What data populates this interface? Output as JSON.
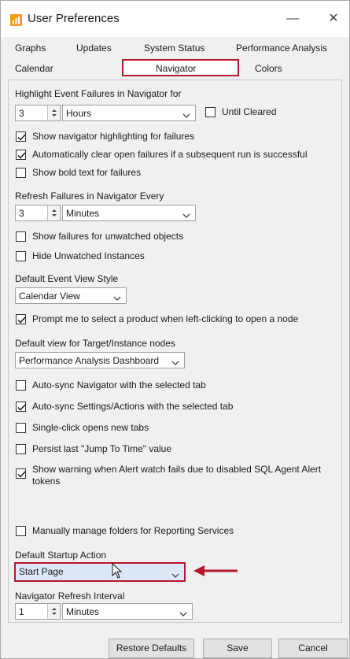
{
  "window": {
    "title": "User Preferences"
  },
  "tabs": {
    "row1": [
      "Graphs",
      "Updates",
      "System Status",
      "Performance Analysis"
    ],
    "row2": [
      "Calendar",
      "Navigator",
      "Colors"
    ],
    "active": "Navigator"
  },
  "highlight": {
    "label": "Highlight Event Failures in Navigator for",
    "value": "3",
    "unit": "Hours",
    "until_cleared": "Until Cleared"
  },
  "options1": [
    {
      "label": "Show navigator highlighting for failures",
      "checked": true
    },
    {
      "label": "Automatically clear open failures if a subsequent run is successful",
      "checked": true
    },
    {
      "label": "Show bold text for failures",
      "checked": false
    }
  ],
  "refresh": {
    "label": "Refresh Failures in Navigator Every",
    "value": "3",
    "unit": "Minutes"
  },
  "options2": [
    {
      "label": "Show failures for unwatched objects",
      "checked": false
    },
    {
      "label": "Hide Unwatched Instances",
      "checked": false
    }
  ],
  "event_view": {
    "label": "Default Event View Style",
    "value": "Calendar View"
  },
  "prompt_select": {
    "label": "Prompt me to select a product when left-clicking to open a node",
    "checked": true
  },
  "target_view": {
    "label": "Default view for Target/Instance nodes",
    "value": "Performance Analysis Dashboard"
  },
  "options3": [
    {
      "label": "Auto-sync Navigator with the selected tab",
      "checked": false
    },
    {
      "label": "Auto-sync Settings/Actions with the selected tab",
      "checked": true
    },
    {
      "label": "Single-click opens new tabs",
      "checked": false
    },
    {
      "label": "Persist last \"Jump To Time\" value",
      "checked": false
    }
  ],
  "warning": {
    "line1": "Show warning when Alert watch fails due to disabled SQL Agent Alert",
    "line2": "tokens",
    "checked": true
  },
  "manual_folders": {
    "label": "Manually manage folders for Reporting Services",
    "checked": false
  },
  "startup": {
    "label": "Default Startup Action",
    "value": "Start Page"
  },
  "nav_refresh": {
    "label": "Navigator Refresh Interval",
    "value": "1",
    "unit": "Minutes"
  },
  "buttons": {
    "restore": "Restore Defaults",
    "save": "Save",
    "cancel": "Cancel"
  },
  "colors": {
    "highlight_box": "#b5182b",
    "annotation_arrow": "#b5182b",
    "startup_bg": "#dce8f7"
  }
}
